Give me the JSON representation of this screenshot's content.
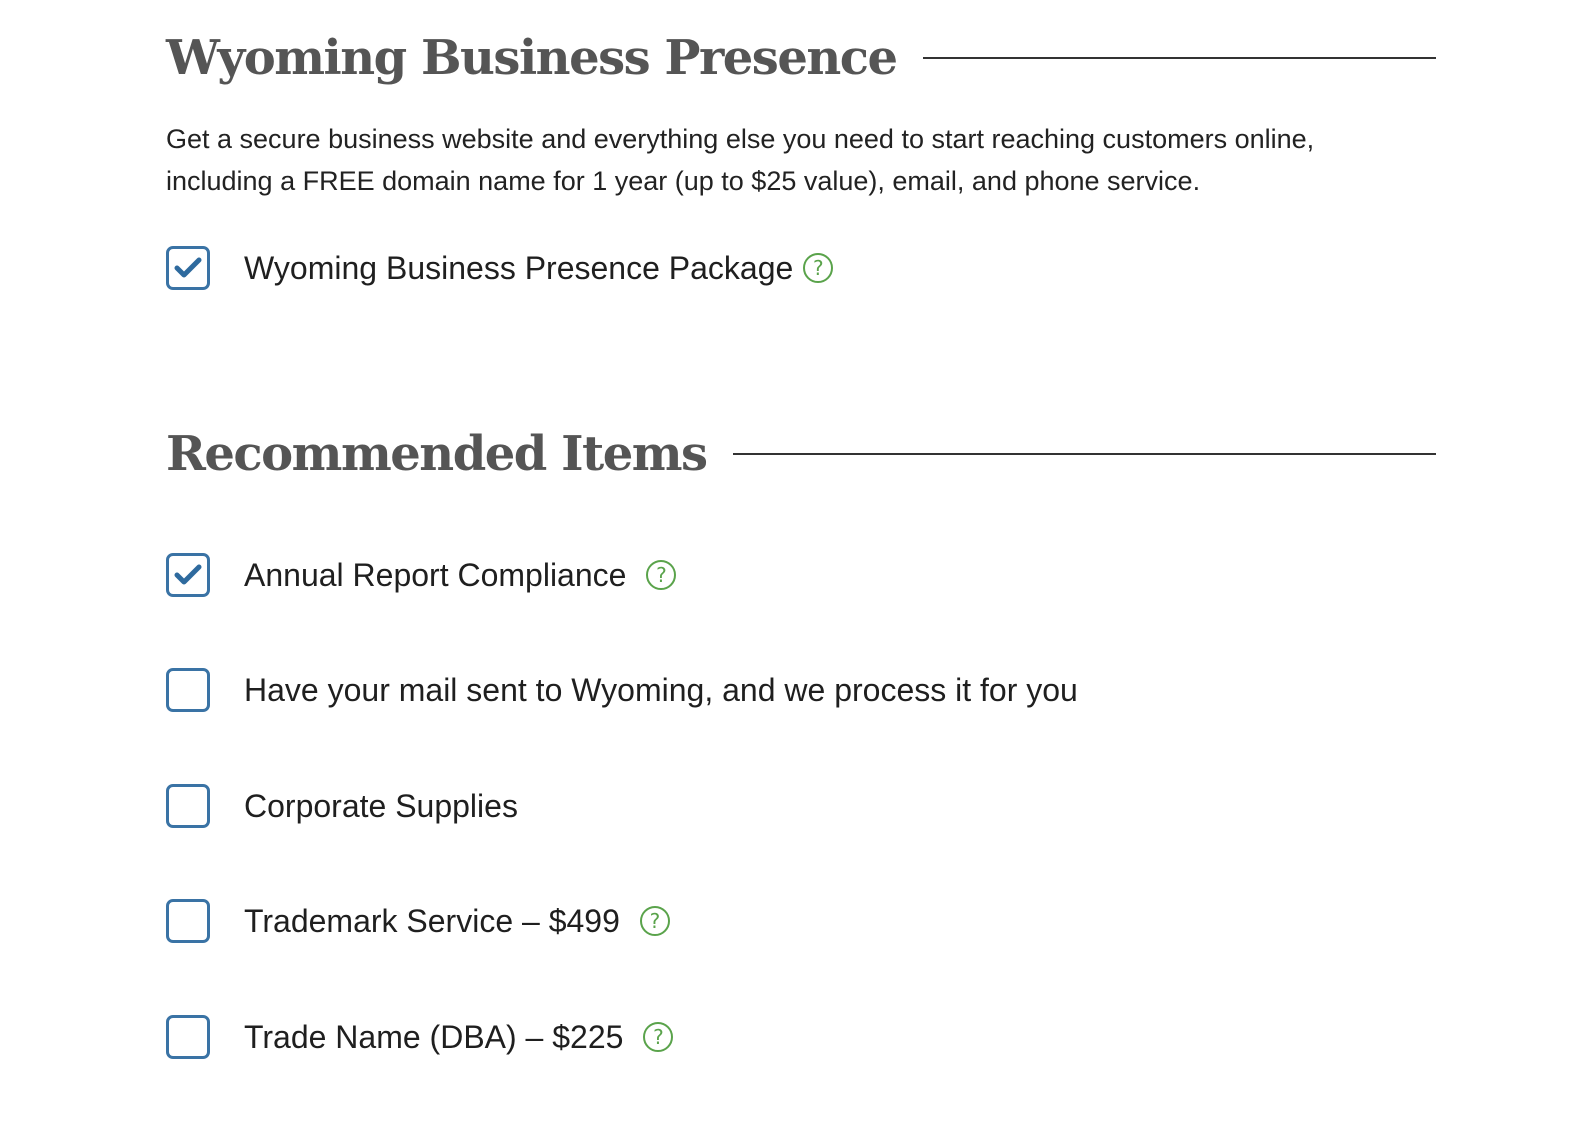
{
  "presence_section": {
    "title": "Wyoming Business Presence",
    "description": "Get a secure business website and everything else you need to start reaching customers online, including a FREE domain name for 1 year (up to $25 value), email, and phone service.",
    "package_option": {
      "label": "Wyoming Business Presence Package",
      "checked": true,
      "help_icon": "question-circle-icon"
    }
  },
  "recommended_section": {
    "title": "Recommended Items",
    "items": [
      {
        "label": "Annual Report Compliance",
        "checked": true,
        "help_icon": "question-circle-icon"
      },
      {
        "label": "Have your mail sent to Wyoming, and we process it for you",
        "checked": false
      },
      {
        "label": "Corporate Supplies",
        "checked": false
      },
      {
        "label": "Trademark Service – $499",
        "checked": false,
        "help_icon": "question-circle-icon"
      },
      {
        "label": "Trade Name (DBA) – $225",
        "checked": false,
        "help_icon": "question-circle-icon"
      }
    ]
  },
  "help_icon_glyph": "?",
  "colors": {
    "checkbox_border": "#3a73a5",
    "checkmark": "#2e6a9e",
    "help_icon": "#5aa34b",
    "heading": "#555555",
    "rule": "#333333",
    "text": "#1f1f1f"
  }
}
